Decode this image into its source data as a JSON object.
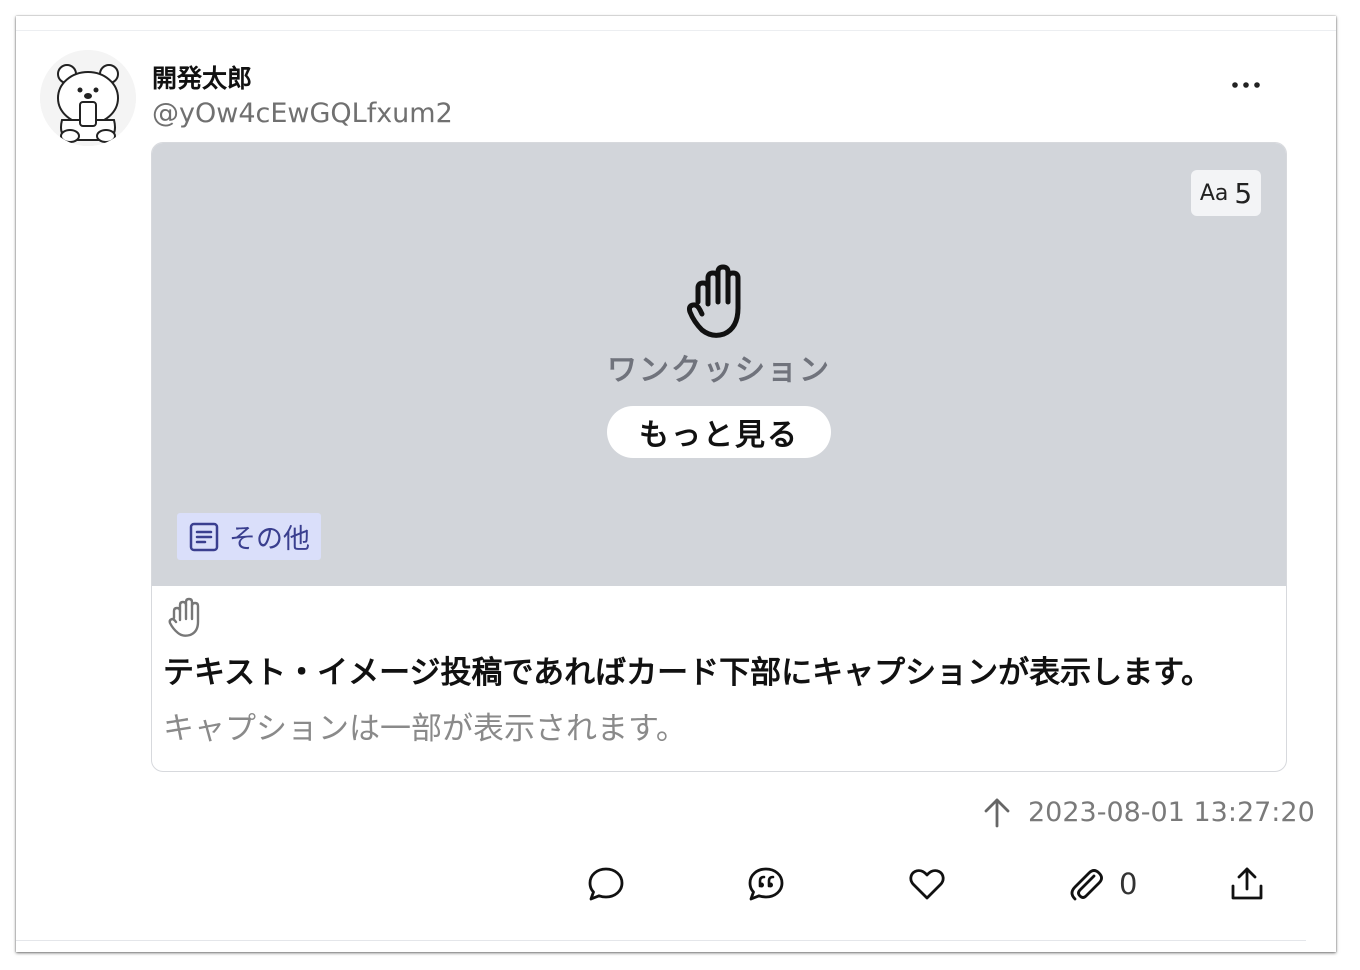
{
  "post": {
    "author": {
      "display_name": "開発太郎",
      "handle": "@yOw4cEwGQLfxum2",
      "avatar_icon": "bear-avatar-icon"
    },
    "more_icon": "more-horizontal-icon",
    "card": {
      "font_badge": {
        "aa": "Aa",
        "count": "5"
      },
      "content_warning": {
        "icon": "hand-stop-icon",
        "label": "ワンクッション",
        "see_more_label": "もっと見る"
      },
      "category": {
        "icon": "document-icon",
        "label": "その他"
      },
      "caption": {
        "icon": "hand-stop-icon",
        "title": "テキスト・イメージ投稿であればカード下部にキャプションが表示します。",
        "body": "キャプションは一部が表示されます。"
      },
      "colors": {
        "preview_background": "#d2d5da",
        "category_background": "#dadffa",
        "category_text": "#3a3f8f"
      }
    },
    "meta": {
      "direction_icon": "arrow-up-icon",
      "timestamp": "2023-08-01 13:27:20"
    },
    "actions": {
      "reply_icon": "speech-bubble-icon",
      "quote_icon": "quote-bubble-icon",
      "like_icon": "heart-icon",
      "clip_icon": "paperclip-icon",
      "clip_count": "0",
      "share_icon": "share-upload-icon"
    }
  }
}
